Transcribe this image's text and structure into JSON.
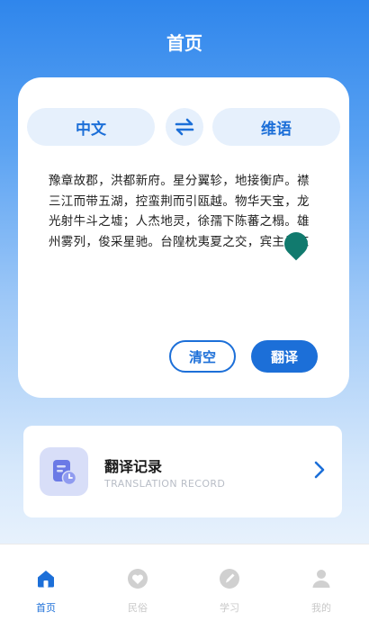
{
  "header": {
    "title": "首页"
  },
  "translator": {
    "source_lang": "中文",
    "target_lang": "维语",
    "swap_icon": "swap-arrows-icon",
    "source_text": "豫章故郡，洪都新府。星分翼轸，地接衡庐。襟三江而带五湖，控蛮荆而引瓯越。物华天宝，龙光射牛斗之墟；人杰地灵，徐孺下陈蕃之榻。雄州雾列，俊采星驰。台隍枕夷夏之交，宾主尽东",
    "clear_label": "清空",
    "translate_label": "翻译"
  },
  "record": {
    "title": "翻译记录",
    "subtitle": "TRANSLATION RECORD",
    "icon": "document-clock-icon"
  },
  "nav": {
    "items": [
      {
        "label": "首页",
        "icon": "home-icon",
        "active": true
      },
      {
        "label": "民俗",
        "icon": "heart-badge-icon",
        "active": false
      },
      {
        "label": "学习",
        "icon": "pencil-circle-icon",
        "active": false
      },
      {
        "label": "我的",
        "icon": "user-icon",
        "active": false
      }
    ]
  },
  "colors": {
    "accent": "#1c6fd8",
    "header_blue": "#2f86ec",
    "pill_bg": "#e6f0fc",
    "inactive_nav": "#c8c8c8"
  }
}
